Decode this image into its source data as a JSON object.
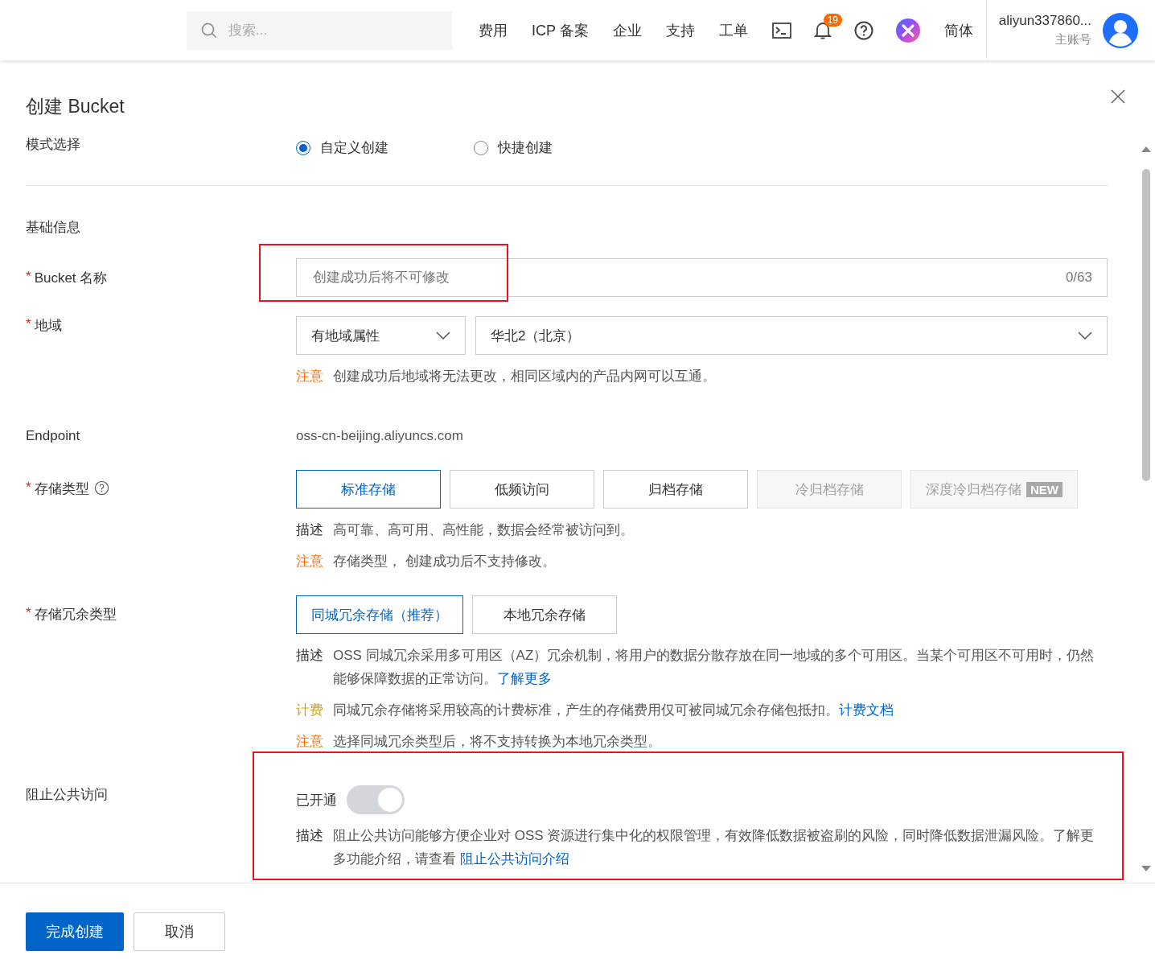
{
  "header": {
    "search": {
      "placeholder": "搜索..."
    },
    "nav": [
      "费用",
      "ICP 备案",
      "企业",
      "支持",
      "工单"
    ],
    "notifications": {
      "count": "19"
    },
    "language": "简体",
    "user": {
      "name": "aliyun337860...",
      "role": "主账号"
    }
  },
  "dialog": {
    "title": "创建 Bucket",
    "fields": [
      {
        "kind": "radio",
        "label": "模式选择",
        "options": [
          {
            "label": "自定义创建",
            "selected": true
          },
          {
            "label": "快捷创建",
            "selected": false
          }
        ]
      },
      {
        "kind": "section",
        "label": "基础信息"
      },
      {
        "kind": "input",
        "label": "Bucket 名称",
        "required_mark": "*",
        "placeholder": "创建成功后将不可修改",
        "counter": "0/63",
        "highlighted": true
      },
      {
        "kind": "selects",
        "label": "地域",
        "required_mark": "*",
        "selects": [
          {
            "value": "有地域属性"
          },
          {
            "value": "华北2（北京）"
          }
        ],
        "notes": [
          {
            "kind": "note",
            "tag": "注意",
            "text": "创建成功后地域将无法更改，相同区域内的产品内网可以互通。"
          }
        ]
      },
      {
        "kind": "static",
        "label": "Endpoint",
        "value": "oss-cn-beijing.aliyuncs.com"
      },
      {
        "kind": "options",
        "label": "存储类型",
        "required_mark": "*",
        "help": true,
        "options": [
          {
            "label": "标准存储",
            "selected": true,
            "disabled": false
          },
          {
            "label": "低频访问",
            "selected": false,
            "disabled": false
          },
          {
            "label": "归档存储",
            "selected": false,
            "disabled": false
          },
          {
            "label": "冷归档存储",
            "selected": false,
            "disabled": true
          },
          {
            "label": "深度冷归档存储",
            "selected": false,
            "disabled": true,
            "badge": "NEW"
          }
        ],
        "notes": [
          {
            "kind": "desc",
            "tag": "描述",
            "text": "高可靠、高可用、高性能，数据会经常被访问到。"
          },
          {
            "kind": "note",
            "tag": "注意",
            "text": "存储类型， 创建成功后不支持修改。"
          }
        ]
      },
      {
        "kind": "options",
        "label": "存储冗余类型",
        "required_mark": "*",
        "options": [
          {
            "label": "同城冗余存储（推荐）",
            "selected": true,
            "disabled": false
          },
          {
            "label": "本地冗余存储",
            "selected": false,
            "disabled": false
          }
        ],
        "notes": [
          {
            "kind": "desc",
            "tag": "描述",
            "text": "OSS 同城冗余采用多可用区（AZ）冗余机制，将用户的数据分散存放在同一地域的多个可用区。当某个可用区不可用时，仍然能够保障数据的正常访问。",
            "link": "了解更多"
          },
          {
            "kind": "billing",
            "tag": "计费",
            "text": "同城冗余存储将采用较高的计费标准，产生的存储费用仅可被同城冗余存储包抵扣。",
            "link": "计费文档"
          },
          {
            "kind": "note",
            "tag": "注意",
            "text": "选择同城冗余类型后，将不支持转换为本地冗余类型。"
          }
        ]
      },
      {
        "kind": "toggle",
        "label": "阻止公共访问",
        "status": "已开通",
        "on": true,
        "disabled": true,
        "highlighted": true,
        "notes": [
          {
            "kind": "desc",
            "tag": "描述",
            "text": "阻止公共访问能够方便企业对 OSS 资源进行集中化的权限管理，有效降低数据被盗刷的风险，同时降低数据泄漏风险。了解更多功能介绍，请查看 ",
            "link": "阻止公共访问介绍"
          }
        ]
      }
    ]
  },
  "footer": {
    "buttons": [
      {
        "label": "完成创建",
        "primary": true
      },
      {
        "label": "取消",
        "primary": false
      }
    ]
  }
}
